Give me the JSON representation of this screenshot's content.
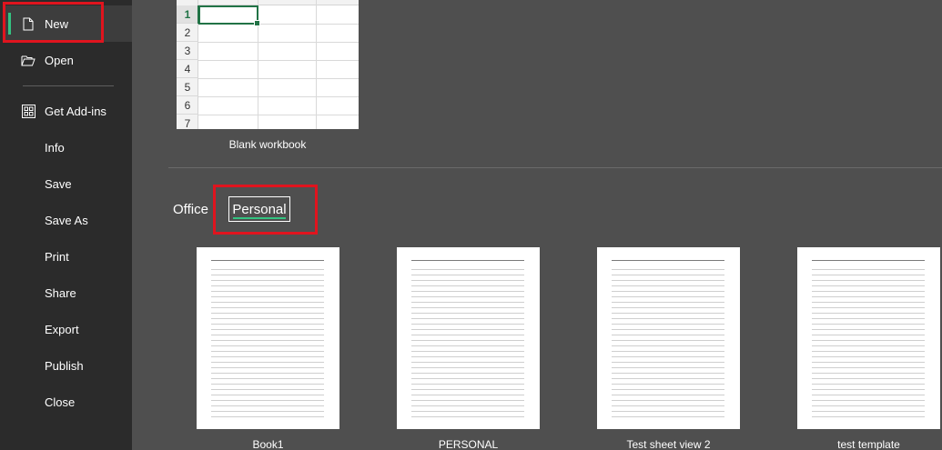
{
  "sidebar": {
    "items": [
      {
        "id": "new",
        "label": "New",
        "icon": "document-icon",
        "active": true
      },
      {
        "id": "open",
        "label": "Open",
        "icon": "folder-open-icon"
      },
      {
        "id": "addins",
        "label": "Get Add-ins",
        "icon": "grid-icon"
      },
      {
        "id": "info",
        "label": "Info"
      },
      {
        "id": "save",
        "label": "Save"
      },
      {
        "id": "saveas",
        "label": "Save As"
      },
      {
        "id": "print",
        "label": "Print"
      },
      {
        "id": "share",
        "label": "Share"
      },
      {
        "id": "export",
        "label": "Export"
      },
      {
        "id": "publish",
        "label": "Publish"
      },
      {
        "id": "close",
        "label": "Close"
      }
    ]
  },
  "blank_workbook": {
    "label": "Blank workbook",
    "row_numbers": [
      "1",
      "2",
      "3",
      "4",
      "5",
      "6",
      "7"
    ]
  },
  "tabs": {
    "office": "Office",
    "personal": "Personal",
    "selected": "Personal"
  },
  "templates": [
    {
      "label": "Book1"
    },
    {
      "label": "PERSONAL"
    },
    {
      "label": "Test sheet view 2"
    },
    {
      "label": "test template"
    }
  ],
  "colors": {
    "accent": "#33c481",
    "excel_green": "#217346",
    "highlight": "#e0141e",
    "sidebar_bg": "#2b2b2b",
    "main_bg": "#4f4f4f"
  }
}
